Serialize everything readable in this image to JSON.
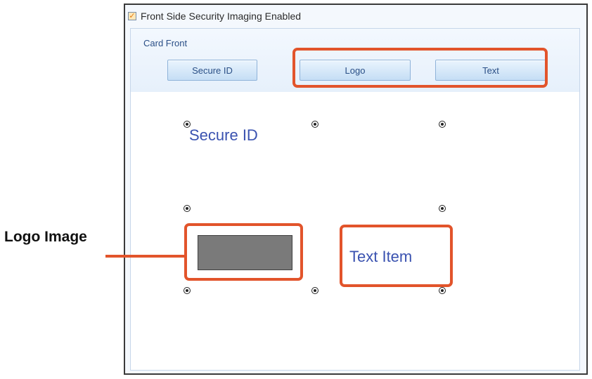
{
  "dialog": {
    "checkbox_checked": true,
    "checkbox_label": "Front Side Security Imaging Enabled",
    "group_title": "Card Front",
    "buttons": {
      "secure_id": "Secure ID",
      "logo": "Logo",
      "text": "Text"
    },
    "canvas": {
      "secure_id_item": "Secure ID",
      "text_item": "Text Item"
    }
  },
  "annotations": {
    "logo_image_label": "Logo Image",
    "callout_color": "#e2542b"
  },
  "colors": {
    "item_text": "#3a52b0",
    "logo_fill": "#7a7a7a",
    "group_title": "#2a4f86"
  }
}
